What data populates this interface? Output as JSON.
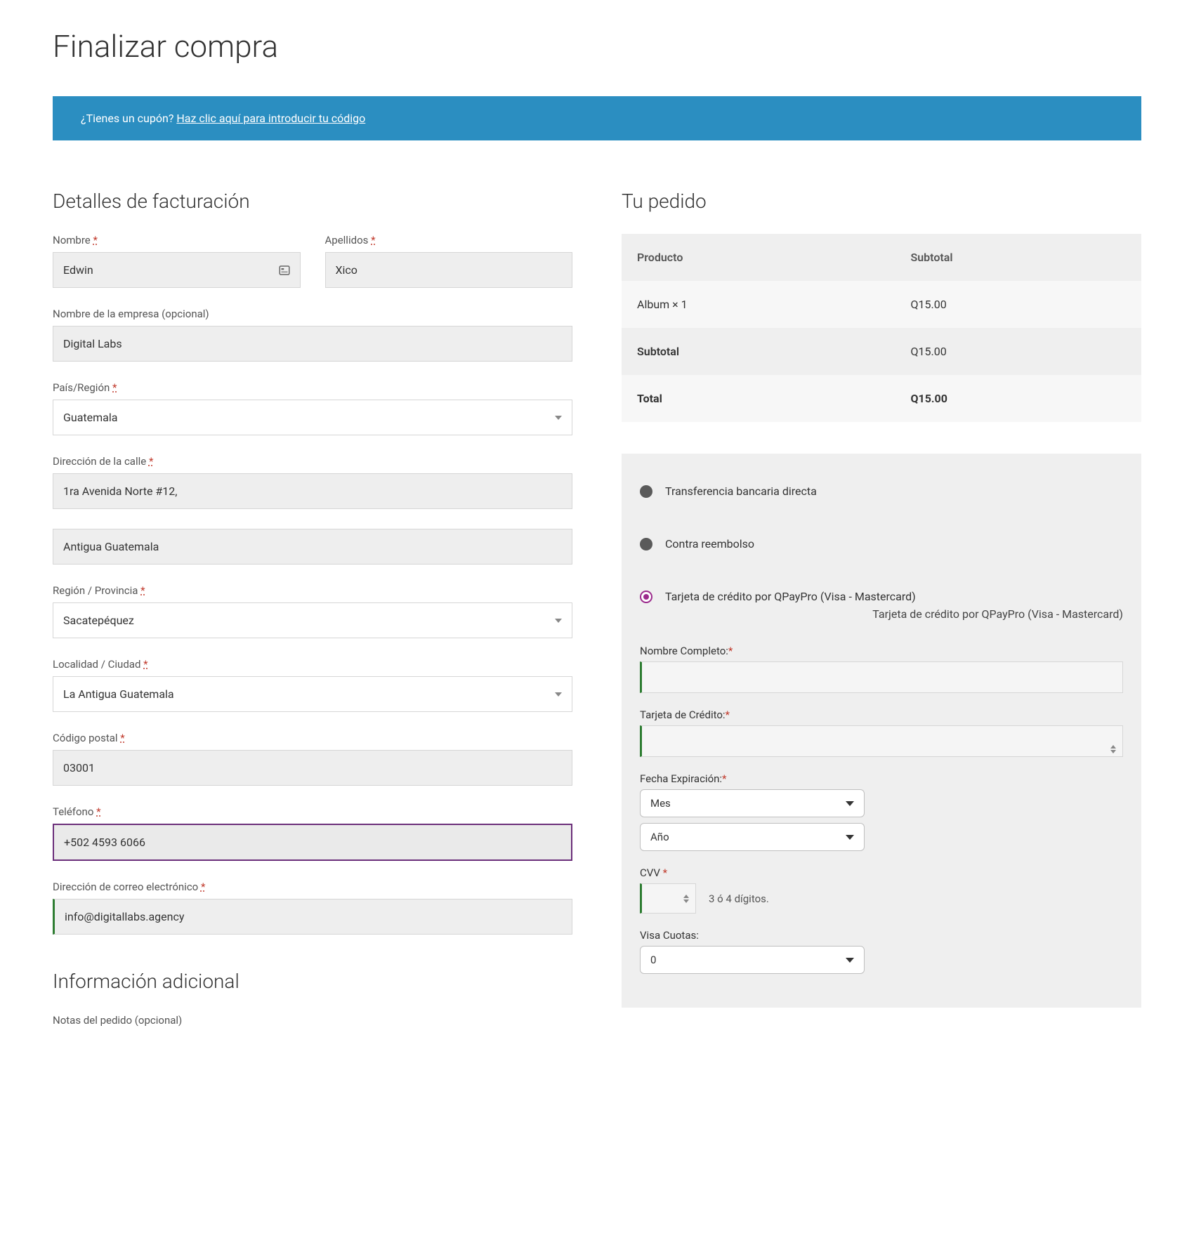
{
  "page_title": "Finalizar compra",
  "coupon": {
    "question": "¿Tienes un cupón? ",
    "link": "Haz clic aquí para introducir tu código"
  },
  "billing": {
    "heading": "Detalles de facturación",
    "first_name_label": "Nombre ",
    "first_name_value": "Edwin",
    "last_name_label": "Apellidos ",
    "last_name_value": "Xico",
    "company_label": "Nombre de la empresa (opcional)",
    "company_value": "Digital Labs",
    "country_label": "País/Región ",
    "country_value": "Guatemala",
    "street_label": "Dirección de la calle ",
    "street1_value": "1ra Avenida Norte #12,",
    "street2_value": "Antigua Guatemala",
    "region_label": "Región / Provincia ",
    "region_value": "Sacatepéquez",
    "city_label": "Localidad / Ciudad ",
    "city_value": "La Antigua Guatemala",
    "postcode_label": "Código postal ",
    "postcode_value": "03001",
    "phone_label": "Teléfono ",
    "phone_value": "+502 4593 6066",
    "email_label": "Dirección de correo electrónico ",
    "email_value": "info@digitallabs.agency",
    "required_mark": "*"
  },
  "additional": {
    "heading": "Información adicional",
    "notes_label": "Notas del pedido (opcional)"
  },
  "order": {
    "heading": "Tu pedido",
    "col_product": "Producto",
    "col_subtotal": "Subtotal",
    "line_item": "Album  × 1",
    "line_price": "Q15.00",
    "subtotal_label": "Subtotal",
    "subtotal_value": "Q15.00",
    "total_label": "Total",
    "total_value": "Q15.00"
  },
  "payment": {
    "opt_bank": "Transferencia bancaria directa",
    "opt_cod": "Contra reembolso",
    "opt_card": "Tarjeta de crédito por QPayPro (Visa - Mastercard)",
    "card_desc": "Tarjeta de crédito por QPayPro (Visa - Mastercard)",
    "cc_name_label": "Nombre Completo:",
    "cc_num_label": "Tarjeta de Crédito:",
    "cc_exp_label": "Fecha Expiración:",
    "cc_exp_month": "Mes",
    "cc_exp_year": "Año",
    "cvv_label": "CVV ",
    "cvv_help": "3 ó 4 dígitos.",
    "visa_cuotas_label": "Visa Cuotas:",
    "visa_cuotas_value": "0",
    "req": "*"
  }
}
